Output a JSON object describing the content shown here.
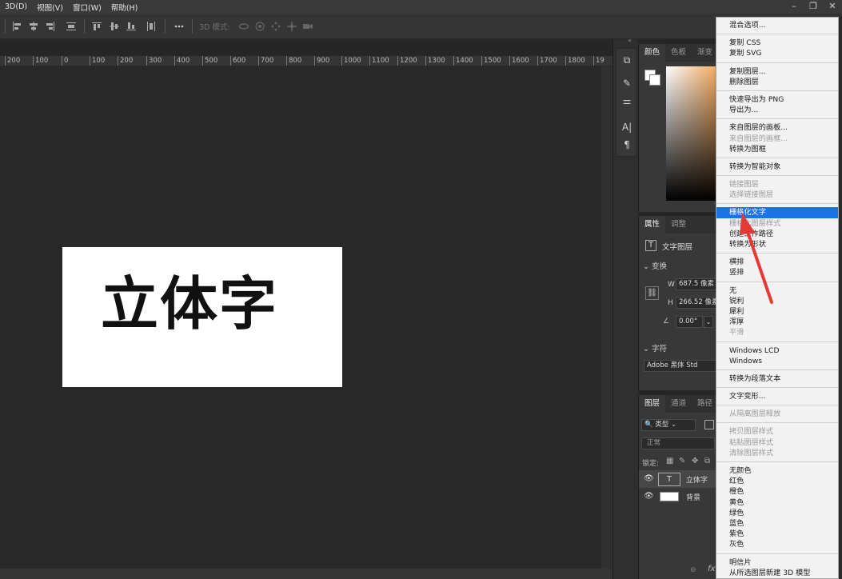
{
  "menubar": {
    "items": [
      "3D(D)",
      "视图(V)",
      "窗口(W)",
      "帮助(H)"
    ],
    "controls": [
      "–",
      "❐",
      "✕"
    ]
  },
  "options_bar": {
    "mode_label": "3D 模式:"
  },
  "ruler": {
    "ticks": [
      "200",
      "100",
      "0",
      "100",
      "200",
      "300",
      "400",
      "500",
      "600",
      "700",
      "800",
      "900",
      "1000",
      "1100",
      "1200",
      "1300",
      "1400",
      "1500",
      "1600",
      "1700",
      "1800",
      "19"
    ]
  },
  "document": {
    "text": "立体字"
  },
  "color_panel": {
    "tabs": [
      "颜色",
      "色板",
      "渐变"
    ]
  },
  "properties_panel": {
    "tabs": [
      "属性",
      "调整"
    ],
    "layer_type": "文字图层",
    "transform_label": "变换",
    "w_label": "W",
    "w_value": "687.5 像素",
    "h_label": "H",
    "h_value": "266.52 像素",
    "angle_value": "0.00°",
    "char_label": "字符",
    "font_value": "Adobe 黑体 Std"
  },
  "layers_panel": {
    "tabs": [
      "图层",
      "通道",
      "路径"
    ],
    "filter_value": "类型",
    "blend_value": "正常",
    "lock_label": "锁定:",
    "layers": [
      {
        "name": "立体字",
        "type": "text"
      },
      {
        "name": "背景",
        "type": "image"
      }
    ],
    "fx_label": "fx"
  },
  "context_menu": {
    "groups": [
      [
        {
          "label": "混合选项...",
          "state": "normal"
        }
      ],
      [
        {
          "label": "复制 CSS",
          "state": "normal"
        },
        {
          "label": "复制 SVG",
          "state": "normal"
        }
      ],
      [
        {
          "label": "复制图层...",
          "state": "normal"
        },
        {
          "label": "删除图层",
          "state": "normal"
        }
      ],
      [
        {
          "label": "快速导出为 PNG",
          "state": "normal"
        },
        {
          "label": "导出为...",
          "state": "normal"
        }
      ],
      [
        {
          "label": "来自图层的画板...",
          "state": "normal"
        },
        {
          "label": "来自图层的画框...",
          "state": "disabled"
        },
        {
          "label": "转换为图框",
          "state": "normal"
        }
      ],
      [
        {
          "label": "转换为智能对象",
          "state": "normal"
        }
      ],
      [
        {
          "label": "链接图层",
          "state": "disabled"
        },
        {
          "label": "选择链接图层",
          "state": "disabled"
        }
      ],
      [
        {
          "label": "栅格化文字",
          "state": "selected"
        },
        {
          "label": "栅格化图层样式",
          "state": "disabled"
        },
        {
          "label": "创建工作路径",
          "state": "normal"
        },
        {
          "label": "转换为形状",
          "state": "normal"
        }
      ],
      [
        {
          "label": "横排",
          "state": "normal"
        },
        {
          "label": "竖排",
          "state": "normal"
        }
      ],
      [
        {
          "label": "无",
          "state": "normal"
        },
        {
          "label": "锐利",
          "state": "normal"
        },
        {
          "label": "犀利",
          "state": "normal"
        },
        {
          "label": "浑厚",
          "state": "normal"
        },
        {
          "label": "平滑",
          "state": "disabled"
        }
      ],
      [
        {
          "label": "Windows LCD",
          "state": "normal"
        },
        {
          "label": "Windows",
          "state": "normal"
        }
      ],
      [
        {
          "label": "转换为段落文本",
          "state": "normal"
        }
      ],
      [
        {
          "label": "文字变形...",
          "state": "normal"
        }
      ],
      [
        {
          "label": "从隔离图层释放",
          "state": "disabled"
        }
      ],
      [
        {
          "label": "拷贝图层样式",
          "state": "disabled"
        },
        {
          "label": "粘贴图层样式",
          "state": "disabled"
        },
        {
          "label": "清除图层样式",
          "state": "disabled"
        }
      ],
      [
        {
          "label": "无颜色",
          "state": "normal"
        },
        {
          "label": "红色",
          "state": "normal"
        },
        {
          "label": "橙色",
          "state": "normal"
        },
        {
          "label": "黄色",
          "state": "normal"
        },
        {
          "label": "绿色",
          "state": "normal"
        },
        {
          "label": "蓝色",
          "state": "normal"
        },
        {
          "label": "紫色",
          "state": "normal"
        },
        {
          "label": "灰色",
          "state": "normal"
        }
      ],
      [
        {
          "label": "明信片",
          "state": "normal"
        },
        {
          "label": "从所选图层新建 3D 模型",
          "state": "normal"
        }
      ]
    ]
  },
  "colors": {
    "menu_selected": "#1a73e8",
    "annotation_arrow": "#e53935",
    "canvas": "#282828"
  }
}
